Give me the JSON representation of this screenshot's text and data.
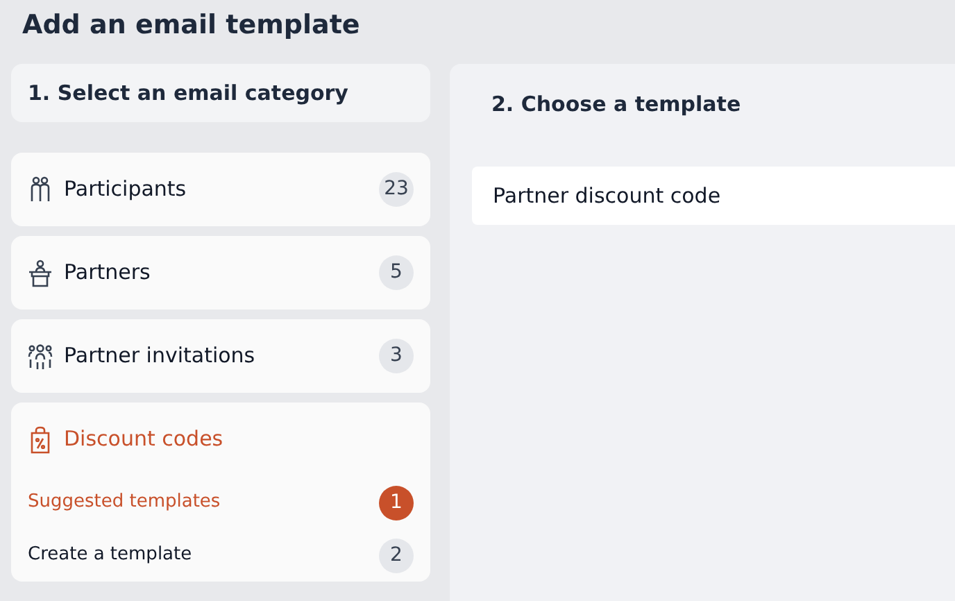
{
  "title": "Add an email template",
  "category_panel": {
    "heading": "1. Select an email category"
  },
  "categories": [
    {
      "label": "Participants",
      "count": "23",
      "selected": false
    },
    {
      "label": "Partners",
      "count": "5",
      "selected": false
    },
    {
      "label": "Partner invitations",
      "count": "3",
      "selected": false
    },
    {
      "label": "Discount codes",
      "selected": true,
      "children": [
        {
          "label": "Suggested templates",
          "count": "1",
          "selected": true
        },
        {
          "label": "Create a template",
          "count": "2",
          "selected": false
        }
      ]
    }
  ],
  "template_panel": {
    "heading": "2. Choose a template",
    "templates": [
      {
        "label": "Partner discount code"
      }
    ]
  }
}
